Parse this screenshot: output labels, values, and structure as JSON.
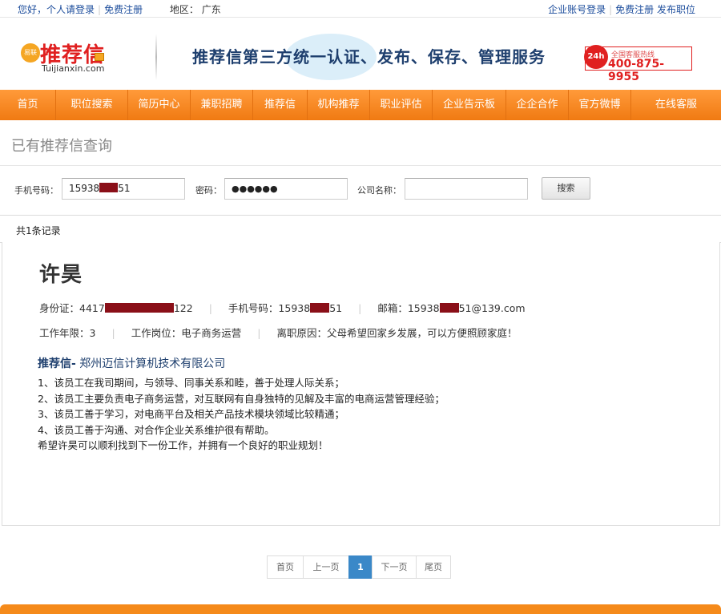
{
  "topbar": {
    "greeting": "您好，个人请登录",
    "register": "免费注册",
    "region_label": "地区：",
    "region_value": "广东",
    "enterprise_login": "企业账号登录",
    "enterprise_register": "免费注册 发布职位"
  },
  "header": {
    "logo_badge": "易联",
    "logo_text": "推荐信",
    "logo_domain": "Tuijianxin.com",
    "slogan": "推荐信第三方统一认证、发布、保存、管理服务",
    "hotline_badge": "24h",
    "hotline_label": "全国客服热线",
    "hotline_number": "400-875-9955"
  },
  "nav": {
    "items": [
      "首页",
      "职位搜索",
      "简历中心",
      "兼职招聘",
      "推荐信",
      "机构推荐",
      "职业评估",
      "企业告示板",
      "企企合作",
      "官方微博",
      "在线客服"
    ]
  },
  "page": {
    "title": "已有推荐信查询"
  },
  "search": {
    "phone_label": "手机号码：",
    "phone_prefix": "15938",
    "phone_suffix": "51",
    "password_label": "密码：",
    "password_value": "●●●●●●",
    "company_label": "公司名称：",
    "company_value": "",
    "button": "搜索"
  },
  "records": {
    "count_text": "共1条记录"
  },
  "record": {
    "name": "许昊",
    "id_label": "身份证：",
    "id_prefix": "4417",
    "id_suffix": "122",
    "phone_label": "手机号码：",
    "phone_prefix": "15938",
    "phone_suffix": "51",
    "email_label": "邮箱：",
    "email_prefix": "15938",
    "email_suffix": "51@139.com",
    "years_label": "工作年限：",
    "years_value": "3",
    "position_label": "工作岗位：",
    "position_value": "电子商务运营",
    "reason_label": "离职原因：",
    "reason_value": "父母希望回家乡发展，可以方便照顾家庭！",
    "letter_key": "推荐信-",
    "letter_company": "郑州迈信计算机技术有限公司",
    "letter_lines": [
      "1、该员工在我司期间，与领导、同事关系和睦，善于处理人际关系；",
      "2、该员工主要负责电子商务运营，对互联网有自身独特的见解及丰富的电商运营管理经验；",
      "3、该员工善于学习，对电商平台及相关产品技术模块领域比较精通；",
      "4、该员工善于沟通、对合作企业关系维护很有帮助。",
      "希望许昊可以顺利找到下一份工作，并拥有一个良好的职业规划！"
    ]
  },
  "pager": {
    "first": "首页",
    "prev": "上一页",
    "current": "1",
    "next": "下一页",
    "last": "尾页"
  },
  "colors": {
    "nav_orange": "#f58a1a",
    "link_blue": "#1a4b9b",
    "brand_red": "#e02020",
    "heading_navy": "#1e3f6e",
    "redaction": "#8a0f18",
    "pager_active": "#3a88c8"
  }
}
